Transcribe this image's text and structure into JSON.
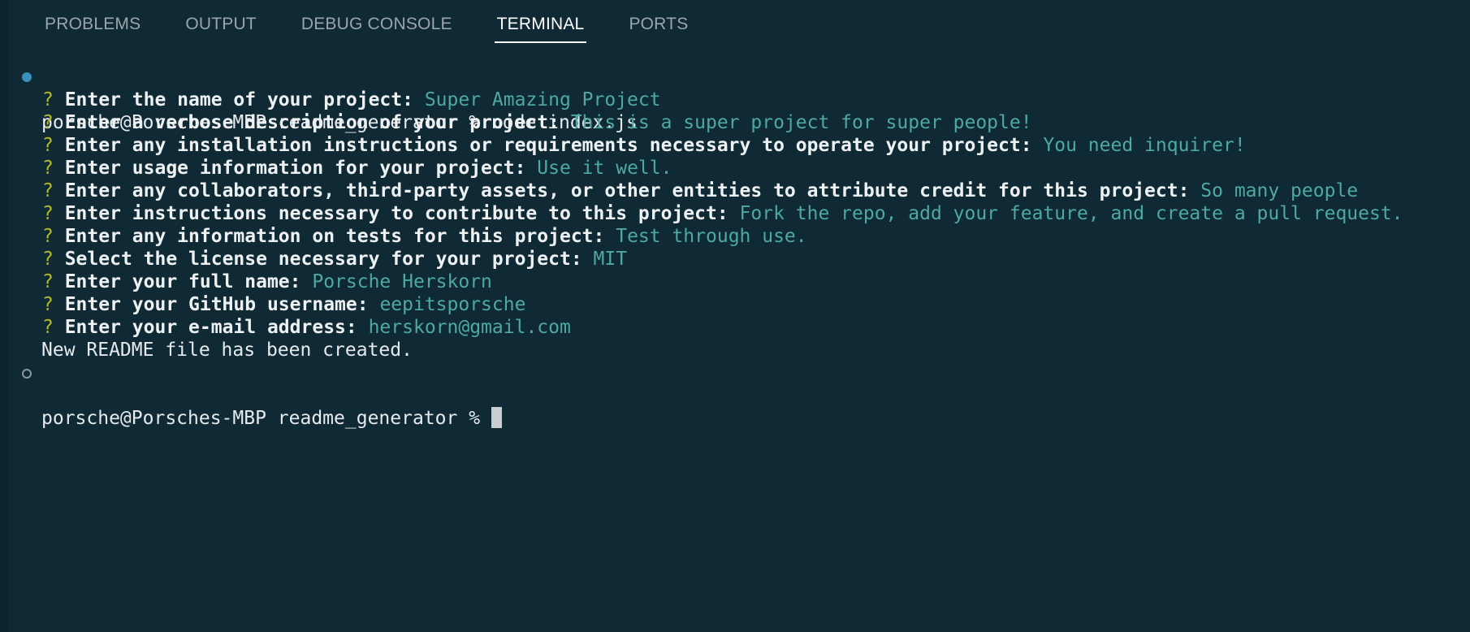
{
  "tabs": [
    {
      "label": "PROBLEMS"
    },
    {
      "label": "OUTPUT"
    },
    {
      "label": "DEBUG CONSOLE"
    },
    {
      "label": "TERMINAL"
    },
    {
      "label": "PORTS"
    }
  ],
  "terminal": {
    "command_line": {
      "prompt": "porsche@Porsches-MBP readme_generator % ",
      "command": "node index.js"
    },
    "questions": [
      {
        "mark": "? ",
        "question": "Enter the name of your project: ",
        "answer": "Super Amazing Project"
      },
      {
        "mark": "? ",
        "question": "Enter a verbose description of your project: ",
        "answer": "This is a super project for super people!"
      },
      {
        "mark": "? ",
        "question": "Enter any installation instructions or requirements necessary to operate your project: ",
        "answer": "You need inquirer!"
      },
      {
        "mark": "? ",
        "question": "Enter usage information for your project: ",
        "answer": "Use it well."
      },
      {
        "mark": "? ",
        "question": "Enter any collaborators, third-party assets, or other entities to attribute credit for this project: ",
        "answer": "So many people"
      },
      {
        "mark": "? ",
        "question": "Enter instructions necessary to contribute to this project: ",
        "answer": "Fork the repo, add your feature, and create a pull request."
      },
      {
        "mark": "? ",
        "question": "Enter any information on tests for this project: ",
        "answer": "Test through use."
      },
      {
        "mark": "? ",
        "question": "Select the license necessary for your project: ",
        "answer": "MIT"
      },
      {
        "mark": "? ",
        "question": "Enter your full name: ",
        "answer": "Porsche Herskorn"
      },
      {
        "mark": "? ",
        "question": "Enter your GitHub username: ",
        "answer": "eepitsporsche"
      },
      {
        "mark": "? ",
        "question": "Enter your e-mail address: ",
        "answer": "herskorn@gmail.com"
      }
    ],
    "result": "New README file has been created.",
    "final_prompt": "porsche@Porsches-MBP readme_generator % "
  },
  "colors": {
    "background": "#0f2935",
    "question_mark": "#b5b81e",
    "answer": "#4ea9a2",
    "run_dot": "#3a8fbd"
  }
}
